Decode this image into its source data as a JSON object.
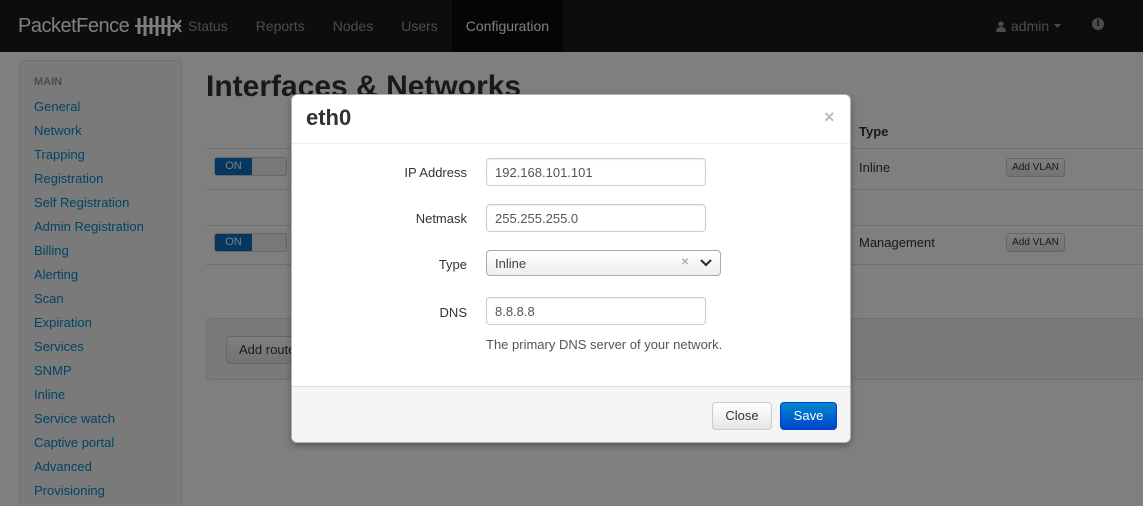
{
  "app": {
    "brand": "PacketFence"
  },
  "nav": {
    "items": [
      {
        "label": "Status"
      },
      {
        "label": "Reports"
      },
      {
        "label": "Nodes"
      },
      {
        "label": "Users"
      },
      {
        "label": "Configuration"
      }
    ],
    "active": "Configuration",
    "user": "admin",
    "icons": {
      "user": "user-icon",
      "caret": "caret-down-icon",
      "info": "info-icon"
    }
  },
  "sidebar": {
    "header": "MAIN",
    "items": [
      {
        "label": "General"
      },
      {
        "label": "Network"
      },
      {
        "label": "Trapping"
      },
      {
        "label": "Registration"
      },
      {
        "label": "Self Registration"
      },
      {
        "label": "Admin Registration"
      },
      {
        "label": "Billing"
      },
      {
        "label": "Alerting"
      },
      {
        "label": "Scan"
      },
      {
        "label": "Expiration"
      },
      {
        "label": "Services"
      },
      {
        "label": "SNMP"
      },
      {
        "label": "Inline"
      },
      {
        "label": "Service watch"
      },
      {
        "label": "Captive portal"
      },
      {
        "label": "Advanced"
      },
      {
        "label": "Provisioning"
      }
    ]
  },
  "main": {
    "title": "Interfaces & Networks",
    "columns": {
      "type": "Type"
    },
    "rows": [
      {
        "switch": "ON",
        "type": "Inline",
        "action": "Add VLAN"
      },
      {
        "switch": "ON",
        "type": "Management",
        "action": "Add VLAN"
      }
    ],
    "add_route_label": "Add route"
  },
  "modal": {
    "title": "eth0",
    "close_glyph": "×",
    "fields": {
      "ip_label": "IP Address",
      "ip_value": "192.168.101.101",
      "netmask_label": "Netmask",
      "netmask_value": "255.255.255.0",
      "type_label": "Type",
      "type_value": "Inline",
      "type_clear": "×",
      "dns_label": "DNS",
      "dns_value": "8.8.8.8",
      "dns_help": "The primary DNS server of your network."
    },
    "footer": {
      "close_label": "Close",
      "save_label": "Save"
    }
  },
  "colors": {
    "accent": "#0088cc",
    "primary_button": "#0044cc",
    "switch_on": "#0a6fc2",
    "navbar": "#1b1b1b"
  }
}
